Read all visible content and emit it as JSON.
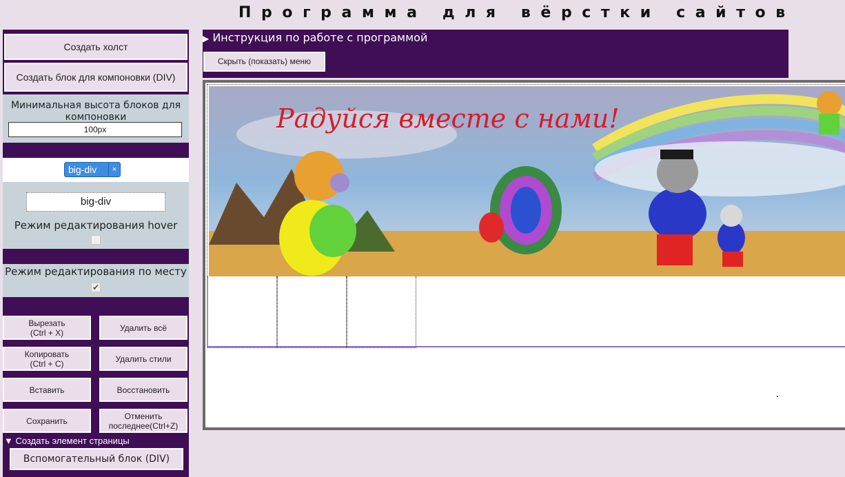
{
  "app": {
    "title": "Программа для вёрстки сайтов"
  },
  "sidebar": {
    "create_canvas": "Создать холст",
    "create_div": "Создать блок для компоновки (DIV)",
    "min_height": {
      "label": "Минимальная высота блоков для компоновки",
      "value": "100px"
    },
    "class_tag": {
      "label": "big-div",
      "remove_icon": "×"
    },
    "class_input_value": "big-div",
    "hover_mode": {
      "label": "Режим редактирования hover",
      "checked": false
    },
    "inplace_mode": {
      "label": "Режим редактирования по месту",
      "checked": true,
      "check_glyph": "✔"
    },
    "buttons": {
      "cut": "Вырезать\n(Ctrl + X)",
      "delete_all": "Удалить всё",
      "copy": "Копировать\n(Ctrl + C)",
      "delete_styles": "Удалить стили",
      "paste": "Вставить",
      "restore": "Восстановить",
      "save": "Сохранить",
      "undo": "Отменить последнее(Ctrl+Z)"
    },
    "create_element": {
      "label": "Создать элемент страницы",
      "marker": "▼"
    },
    "aux_block": "Вспомогательный блок (DIV)"
  },
  "topbar": {
    "instructions": {
      "label": "Инструкция по работе с программой",
      "marker": "▶"
    },
    "toggle_menu": "Скрыть (показать) меню"
  },
  "canvas": {
    "banner_text": "Радуйся вместе с нами!"
  },
  "colors": {
    "sidebar_bg": "#3f0e55",
    "panel_bg": "#c7d3d9",
    "button_bg": "#ebdeeb",
    "tag_blue": "#3e8de0",
    "banner_title": "#d81b2a"
  }
}
